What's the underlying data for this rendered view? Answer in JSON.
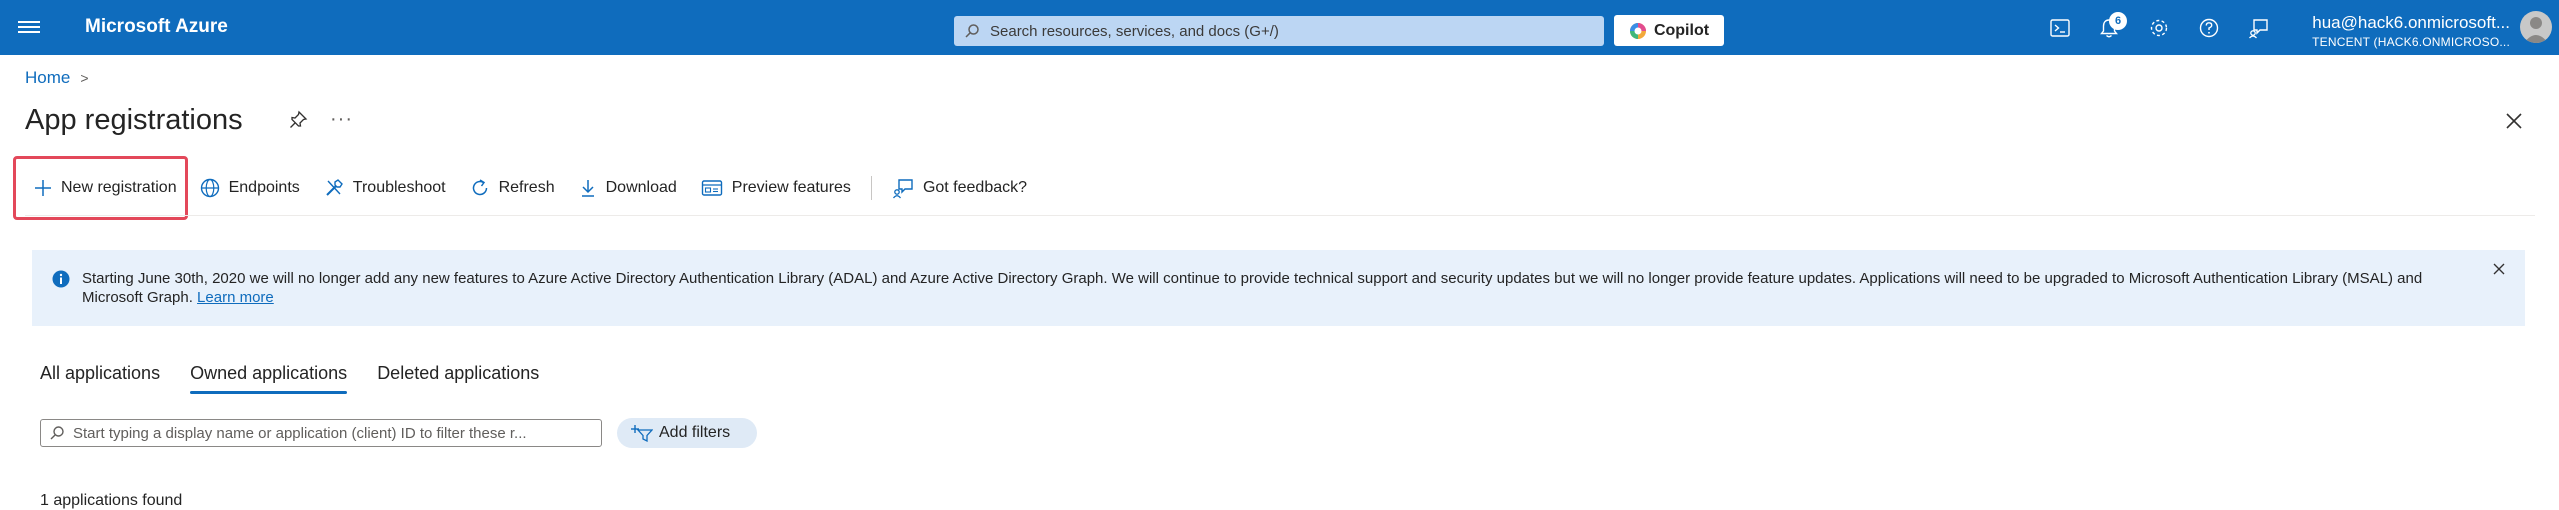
{
  "topbar": {
    "brand": "Microsoft Azure",
    "search_placeholder": "Search resources, services, and docs (G+/)",
    "copilot_label": "Copilot",
    "notification_count": "6",
    "account_email": "hua@hack6.onmicrosoft...",
    "account_tenant": "TENCENT (HACK6.ONMICROSO...",
    "accent_color": "#0f6cbd"
  },
  "breadcrumb": {
    "home": "Home",
    "separator": ">"
  },
  "page": {
    "title": "App registrations",
    "more": "···"
  },
  "toolbar": {
    "new_registration": "New registration",
    "endpoints": "Endpoints",
    "troubleshoot": "Troubleshoot",
    "refresh": "Refresh",
    "download": "Download",
    "preview_features": "Preview features",
    "feedback": "Got feedback?"
  },
  "banner": {
    "message": "Starting June 30th, 2020 we will no longer add any new features to Azure Active Directory Authentication Library (ADAL) and Azure Active Directory Graph. We will continue to provide technical support and security updates but we will no longer provide feature updates. Applications will need to be upgraded to Microsoft Authentication Library (MSAL) and Microsoft Graph.",
    "link": "Learn more"
  },
  "tabs": [
    {
      "label": "All applications"
    },
    {
      "label": "Owned applications"
    },
    {
      "label": "Deleted applications"
    }
  ],
  "filter": {
    "placeholder": "Start typing a display name or application (client) ID to filter these r...",
    "add_filters": "Add filters"
  },
  "results": {
    "count_text": "1 applications found"
  }
}
